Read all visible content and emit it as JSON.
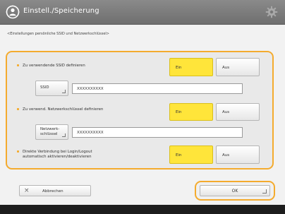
{
  "header": {
    "title": "Einstell./Speicherung",
    "title_icon": "settings-person-icon",
    "right_icon": "gear-icon"
  },
  "subtitle": "<Einstellungen persönliche SSID und Netzwerkschlüssel>",
  "rows": [
    {
      "label": "Zu verwendende SSID definieren",
      "on_label": "Ein",
      "off_label": "Aus",
      "selected": "Ein"
    },
    {
      "label": "Zu verwend. Netzwerkschlüssel definieren",
      "on_label": "Ein",
      "off_label": "Aus",
      "selected": "Ein"
    },
    {
      "label_line1": "Direkte Verbindung bei Login/Logout",
      "label_line2": "automatisch aktivieren/deaktivieren",
      "on_label": "Ein",
      "off_label": "Aus",
      "selected": "Ein"
    }
  ],
  "ssid": {
    "button_label": "SSID",
    "value": "XXXXXXXXXX"
  },
  "network_key": {
    "button_label_line1": "Netzwerk-",
    "button_label_line2": "schlüssel",
    "value": "XXXXXXXXXX"
  },
  "footer": {
    "cancel_label": "Abbrechen",
    "ok_label": "OK"
  },
  "colors": {
    "accent": "#f4ab2e",
    "selected": "#ffe53a",
    "titlebar": "#7a7a7a"
  }
}
